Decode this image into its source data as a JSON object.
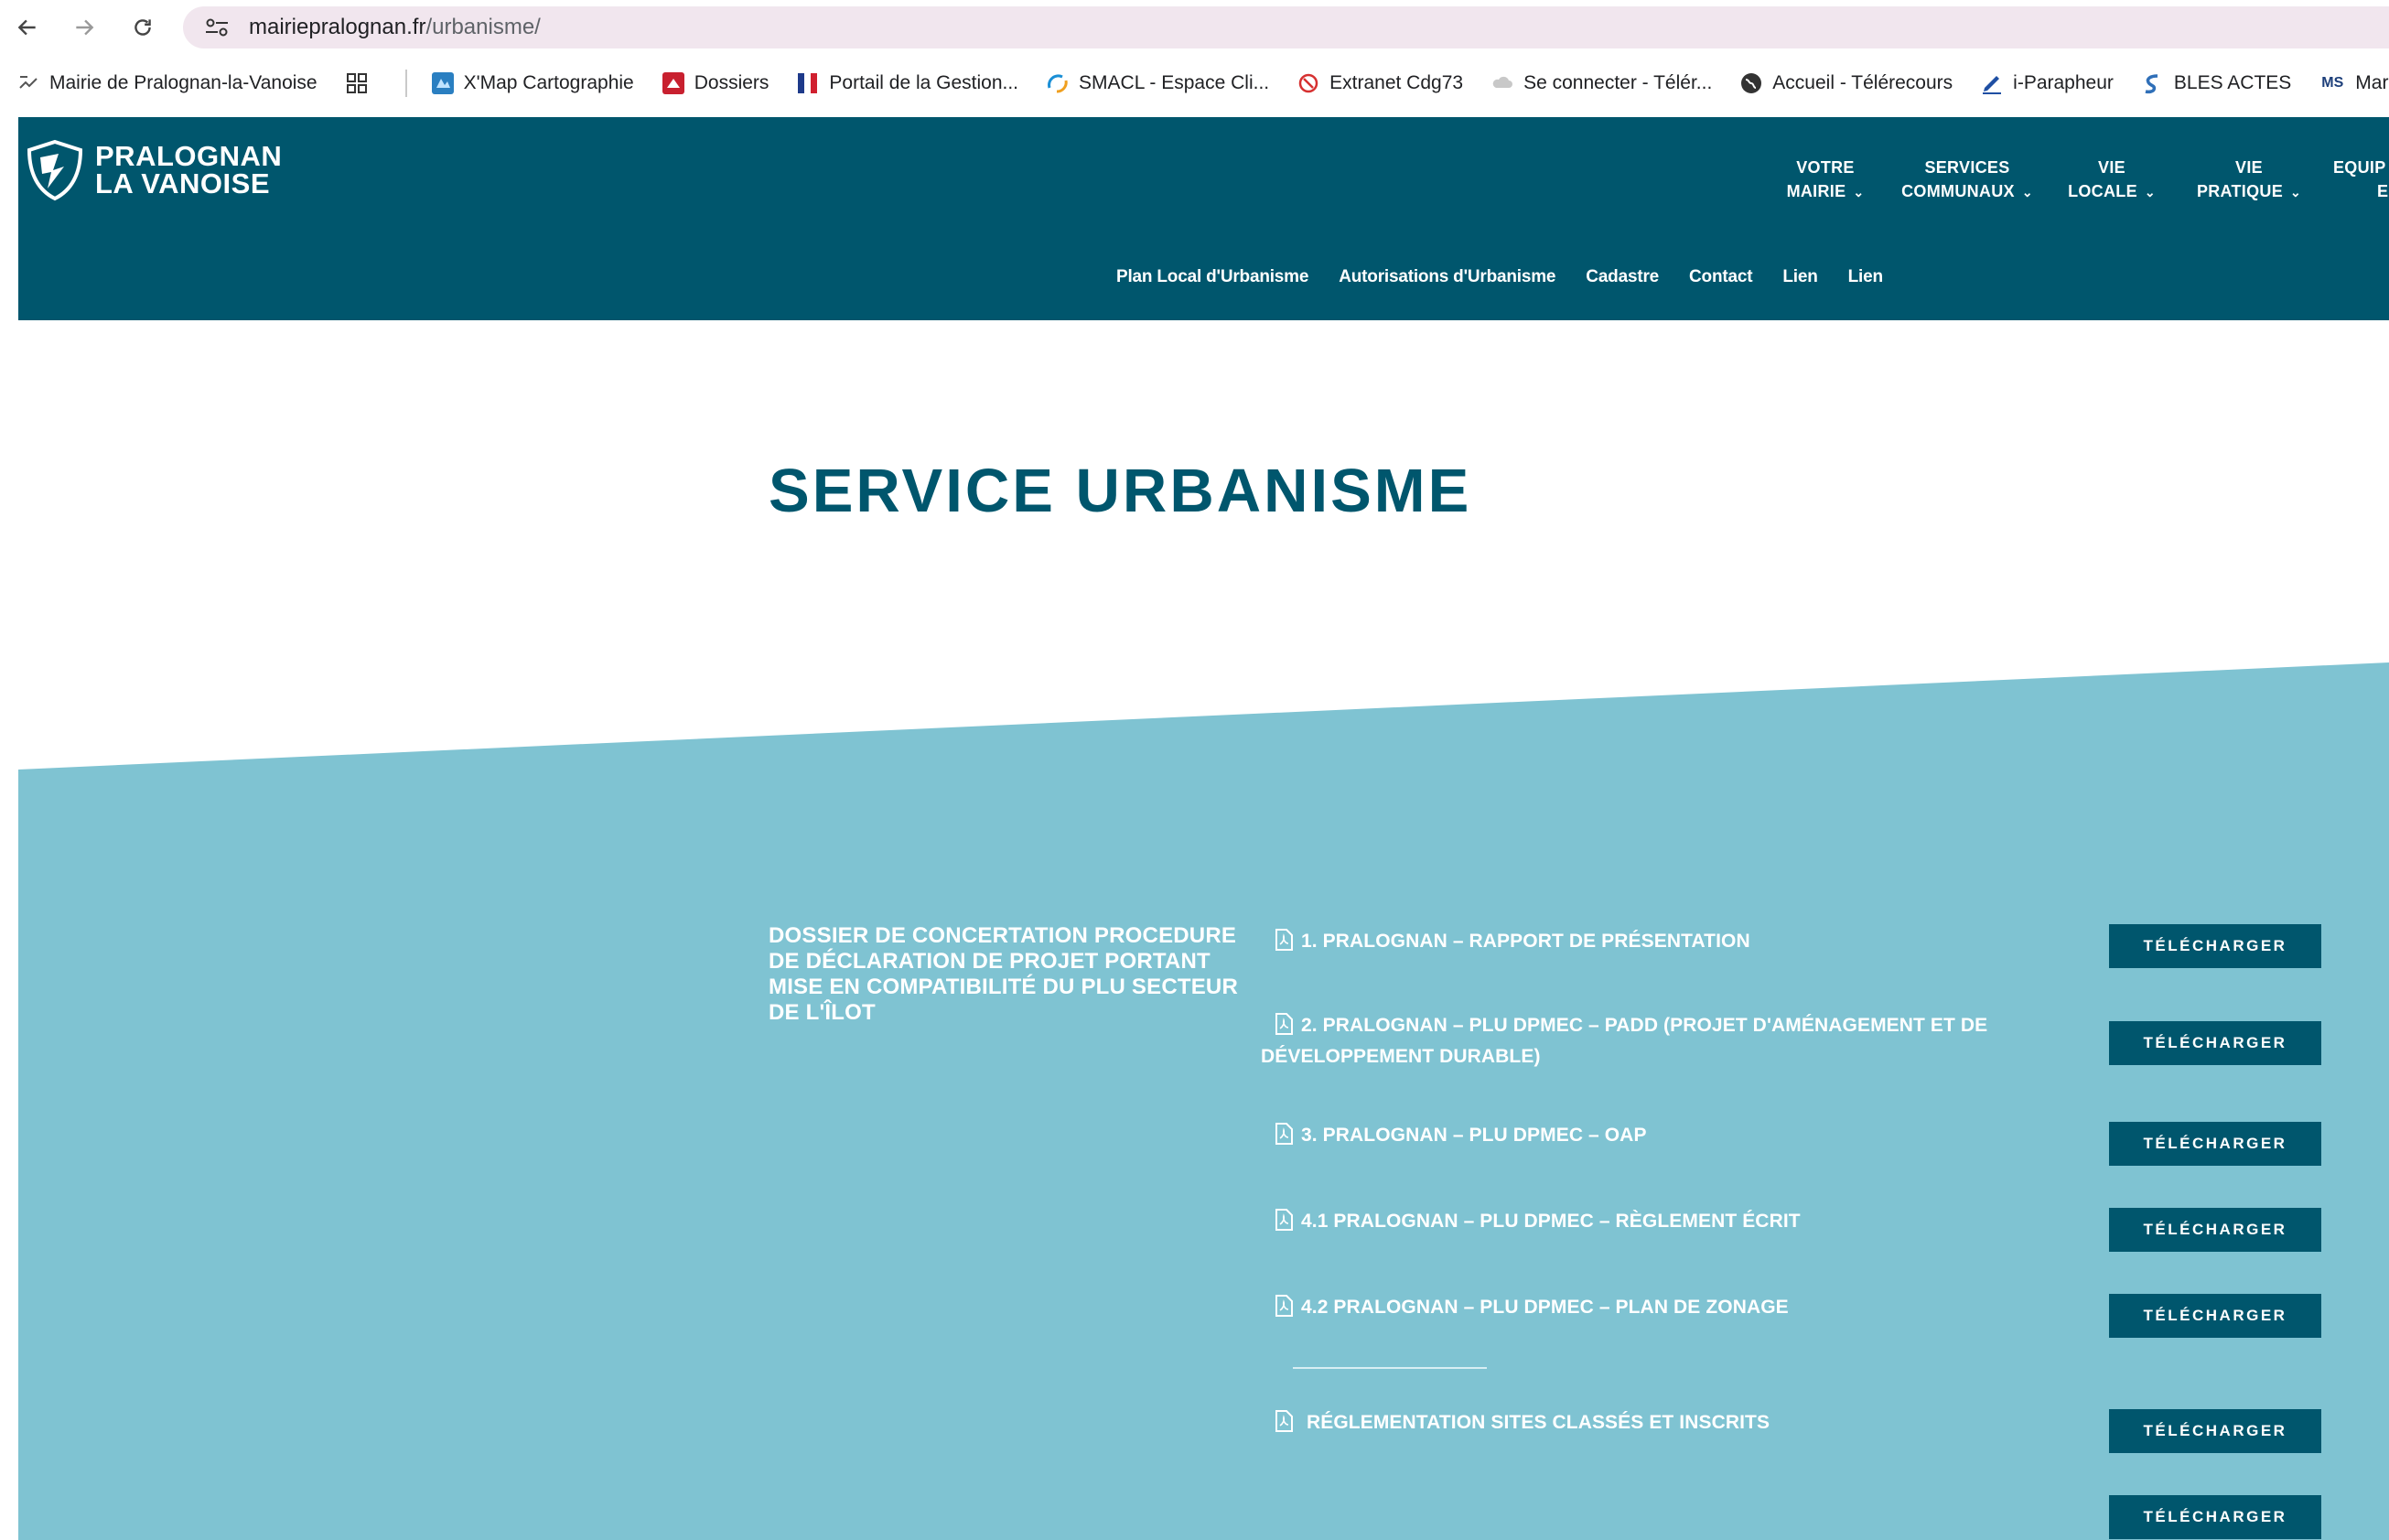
{
  "browser": {
    "url_domain": "mairiepralognan.fr",
    "url_path": "/urbanisme/",
    "bookmarks": [
      {
        "label": "Mairie de Pralognan-la-Vanoise",
        "icon": "page-icon"
      },
      {
        "label": "X'Map Cartographie",
        "icon": "map-icon"
      },
      {
        "label": "Dossiers",
        "icon": "folder-icon"
      },
      {
        "label": "Portail de la Gestion...",
        "icon": "flag-icon"
      },
      {
        "label": "SMACL - Espace Cli...",
        "icon": "smacl-icon"
      },
      {
        "label": "Extranet Cdg73",
        "icon": "cdg-icon"
      },
      {
        "label": "Se connecter - Télér...",
        "icon": "cloud-icon"
      },
      {
        "label": "Accueil - Télérecours",
        "icon": "globe-icon"
      },
      {
        "label": "i-Parapheur",
        "icon": "pen-icon"
      },
      {
        "label": "BLES ACTES",
        "icon": "ble-icon"
      },
      {
        "label": "Marches-se",
        "icon": "ms-icon",
        "icon_text": "MS"
      }
    ]
  },
  "site": {
    "logo_line1": "PRALOGNAN",
    "logo_line2": "LA VANOISE",
    "nav": [
      {
        "line1": "VOTRE",
        "line2": "MAIRIE"
      },
      {
        "line1": "SERVICES",
        "line2": "COMMUNAUX"
      },
      {
        "line1": "VIE",
        "line2": "LOCALE"
      },
      {
        "line1": "VIE",
        "line2": "PRATIQUE"
      },
      {
        "line1": "EQUIP",
        "line2": "E"
      }
    ],
    "subnav": [
      "Plan Local d'Urbanisme",
      "Autorisations d'Urbanisme",
      "Cadastre",
      "Contact",
      "Lien",
      "Lien"
    ]
  },
  "page": {
    "title": "SERVICE URBANISME",
    "dossier_title": "DOSSIER DE CONCERTATION  PROCEDURE DE DÉCLARATION DE PROJET PORTANT MISE EN COMPATIBILITÉ DU PLU SECTEUR DE L'ÎLOT",
    "download_label": "TÉLÉCHARGER",
    "documents": [
      {
        "label": "1. PRALOGNAN – RAPPORT DE PRÉSENTATION"
      },
      {
        "label": "2. PRALOGNAN – PLU DPMEC – PADD (PROJET D'AMÉNAGEMENT ET DE DÉVELOPPEMENT DURABLE)"
      },
      {
        "label": "3. PRALOGNAN – PLU DPMEC – OAP"
      },
      {
        "label": "4.1 PRALOGNAN – PLU DPMEC – RÈGLEMENT ÉCRIT"
      },
      {
        "label": "4.2 PRALOGNAN – PLU DPMEC – PLAN DE ZONAGE"
      },
      {
        "label": "RÉGLEMENTATION SITES CLASSÉS ET INSCRITS"
      },
      {
        "label": ""
      }
    ]
  },
  "colors": {
    "header_bg": "#00566d",
    "band_bg": "#7fc3d2",
    "button_bg": "#00566d"
  }
}
